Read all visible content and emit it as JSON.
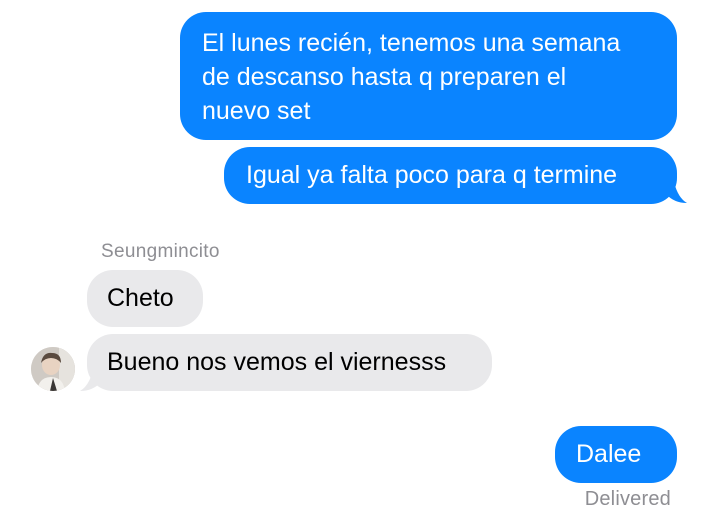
{
  "conversation": {
    "messages": [
      {
        "direction": "sent",
        "text": "El lunes recién, tenemos una semana\nde descanso hasta q preparen el\nnuevo set"
      },
      {
        "direction": "sent",
        "text": "Igual ya falta poco para q termine"
      },
      {
        "direction": "received",
        "text": "Cheto"
      },
      {
        "direction": "received",
        "text": "Bueno nos vemos el viernesss"
      },
      {
        "direction": "sent",
        "text": "Dalee"
      }
    ],
    "sender_name": "Seungmincito",
    "delivery_status": "Delivered"
  },
  "colors": {
    "sent_bubble": "#0a84ff",
    "received_bubble": "#e9e9eb",
    "meta_text": "#8e8e93"
  },
  "icons": {
    "avatar": "user-avatar-photo"
  }
}
